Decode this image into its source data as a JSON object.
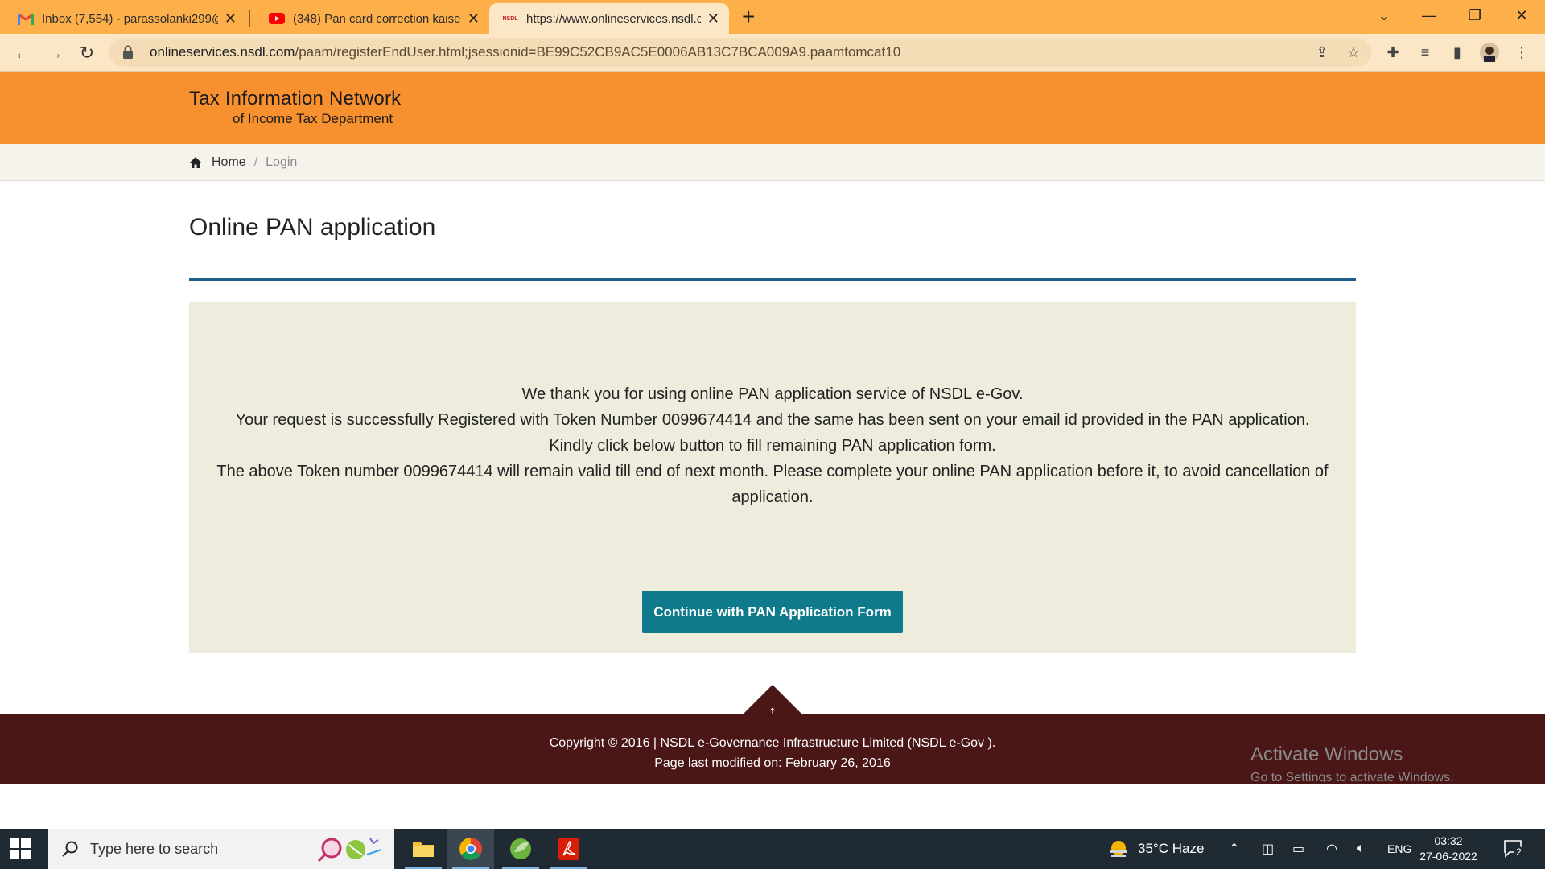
{
  "browser": {
    "tabs": [
      {
        "title": "Inbox (7,554) - parassolanki299@",
        "icon": "gmail-icon"
      },
      {
        "title": "(348) Pan card correction kaise k",
        "icon": "youtube-icon"
      },
      {
        "title": "https://www.onlineservices.nsdl.c",
        "icon": "nsdl-icon",
        "favicon_text": "NSDL"
      }
    ],
    "url_host": "onlineservices.nsdl.com",
    "url_path": "/paam/registerEndUser.html;jsessionid=BE99C52CB9AC5E0006AB13C7BCA009A9.paamtomcat10"
  },
  "site": {
    "logo_line1": "Tax Information Network",
    "logo_line2": "of Income Tax Department"
  },
  "breadcrumb": {
    "home": "Home",
    "separator": "/",
    "current": "Login"
  },
  "main": {
    "title": "Online PAN application",
    "messages": [
      "We thank you for using online PAN application service of NSDL e-Gov.",
      "Your request is successfully Registered with Token Number 0099674414 and the same has been sent on your email id provided in the PAN application.",
      "Kindly click below button to fill remaining PAN application form.",
      "The above Token number 0099674414 will remain valid till end of next month. Please complete your online PAN application before it, to avoid cancellation of application."
    ],
    "button_label": "Continue with PAN Application Form"
  },
  "footer": {
    "copyright": "Copyright © 2016 | NSDL e-Governance Infrastructure Limited (NSDL e-Gov ).",
    "modified": "Page last modified on: February 26, 2016"
  },
  "watermark": {
    "line1": "Activate Windows",
    "line2": "Go to Settings to activate Windows."
  },
  "taskbar": {
    "search_placeholder": "Type here to search",
    "weather": "35°C  Haze",
    "language": "ENG",
    "time": "03:32",
    "date": "27-06-2022",
    "notifications": "2"
  },
  "colors": {
    "tabbar": "#fdb04a",
    "header": "#f7902f",
    "rule": "#1d5f8a",
    "button": "#0e7a8c",
    "footer": "#4a1616"
  }
}
